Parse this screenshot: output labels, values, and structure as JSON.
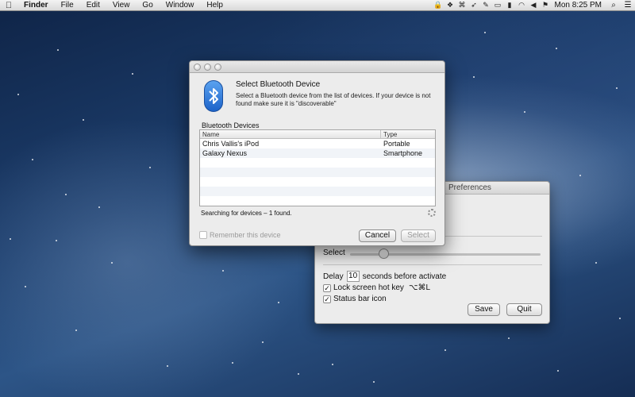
{
  "menubar": {
    "apple": "",
    "items": [
      "Finder",
      "File",
      "Edit",
      "View",
      "Go",
      "Window",
      "Help"
    ],
    "clock": "Mon 8:25 PM",
    "status_icons": [
      "lock-icon",
      "dropbox-icon",
      "bluetooth-app-icon",
      "rocket-icon",
      "evernote-icon",
      "airplay-icon",
      "battery-icon",
      "wifi-icon",
      "volume-icon",
      "flag-icon"
    ],
    "spotlight_icon": "search-icon"
  },
  "bluetooth_dialog": {
    "heading": "Select Bluetooth Device",
    "description": "Select a Bluetooth device from the list of devices. If your device is not found make sure it is \"discoverable\"",
    "list_label": "Bluetooth Devices",
    "columns": [
      "Name",
      "Type"
    ],
    "devices": [
      {
        "name": "Chris Vallis's iPod",
        "type": "Portable"
      },
      {
        "name": "Galaxy Nexus",
        "type": "Smartphone"
      }
    ],
    "status": "Searching for devices – 1 found.",
    "remember_label": "Remember this device",
    "cancel_label": "Cancel",
    "select_label": "Select"
  },
  "prefs_window": {
    "title": "Preferences",
    "select_label": "Select",
    "delay_label": "Delay",
    "delay_value": "10",
    "delay_suffix": "seconds before activate",
    "lock_hotkey_label": "Lock screen hot key",
    "lock_hotkey_shortcut": "⌥⌘L",
    "status_bar_label": "Status bar icon",
    "save_label": "Save",
    "quit_label": "Quit"
  }
}
